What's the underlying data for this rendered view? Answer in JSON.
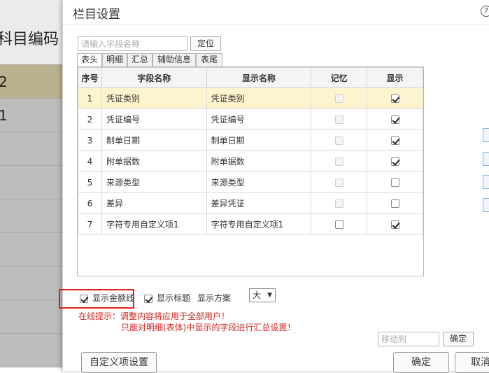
{
  "background": {
    "header": "科目编码",
    "rows": [
      "2",
      "1",
      "",
      "",
      "",
      "",
      "",
      "",
      ""
    ]
  },
  "dialog": {
    "title": "栏目设置",
    "help": "?",
    "search_placeholder": "请输入字段名称",
    "locate_label": "定位",
    "tabs": [
      "表头",
      "明细",
      "汇总",
      "辅助信息",
      "表尾"
    ],
    "columns": [
      "序号",
      "字段名称",
      "显示名称",
      "记忆",
      "显示"
    ],
    "rows": [
      {
        "no": "1",
        "field": "凭证类别",
        "display": "凭证类别",
        "memory": false,
        "memory_enabled": false,
        "show": true
      },
      {
        "no": "2",
        "field": "凭证编号",
        "display": "凭证编号",
        "memory": false,
        "memory_enabled": false,
        "show": true
      },
      {
        "no": "3",
        "field": "制单日期",
        "display": "制单日期",
        "memory": false,
        "memory_enabled": false,
        "show": true
      },
      {
        "no": "4",
        "field": "附单据数",
        "display": "附单据数",
        "memory": false,
        "memory_enabled": false,
        "show": true
      },
      {
        "no": "5",
        "field": "来源类型",
        "display": "来源类型",
        "memory": false,
        "memory_enabled": false,
        "show": false
      },
      {
        "no": "6",
        "field": "差异",
        "display": "差异凭证",
        "memory": false,
        "memory_enabled": false,
        "show": false
      },
      {
        "no": "7",
        "field": "字符专用自定义项1",
        "display": "字符专用自定义项1",
        "memory": false,
        "memory_enabled": true,
        "show": true
      }
    ],
    "options": {
      "show_amount_line": "显示金额线",
      "show_title": "显示标题",
      "plan_label": "显示方案",
      "plan_value": "大"
    },
    "tip_line1": "在线提示：调整内容将应用于全部用户！",
    "tip_line2": "只能对明细(表体)中显示的字段进行汇总设置！",
    "move_placeholder": "移动到",
    "move_ok": "确定",
    "custom_items": "自定义项设置",
    "confirm": "确定",
    "cancel": "取消"
  }
}
